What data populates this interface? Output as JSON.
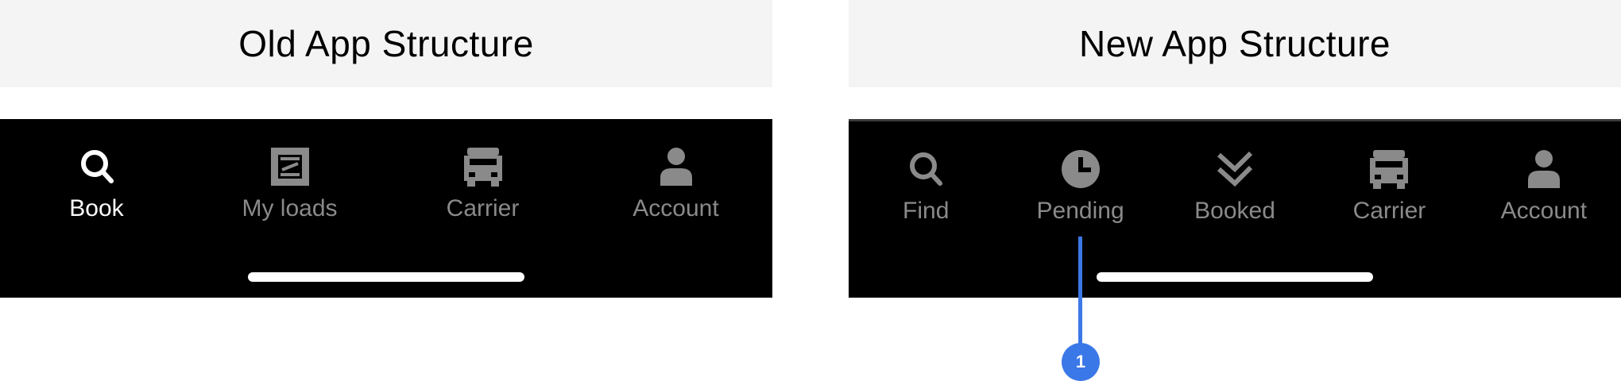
{
  "old_panel": {
    "title": "Old App Structure",
    "tabs": [
      {
        "label": "Book",
        "icon": "search-icon",
        "active": true
      },
      {
        "label": "My loads",
        "icon": "loads-icon",
        "active": false
      },
      {
        "label": "Carrier",
        "icon": "truck-icon",
        "active": false
      },
      {
        "label": "Account",
        "icon": "person-icon",
        "active": false
      }
    ]
  },
  "new_panel": {
    "title": "New App Structure",
    "tabs": [
      {
        "label": "Find",
        "icon": "search-icon",
        "active": false
      },
      {
        "label": "Pending",
        "icon": "clock-icon",
        "active": false
      },
      {
        "label": "Booked",
        "icon": "double-check-icon",
        "active": false
      },
      {
        "label": "Carrier",
        "icon": "truck-icon",
        "active": false
      },
      {
        "label": "Account",
        "icon": "person-icon",
        "active": false
      }
    ]
  },
  "callout": {
    "number": "1",
    "target": "Pending"
  },
  "colors": {
    "title_band": "#f4f4f4",
    "tabbar": "#000000",
    "active": "#ffffff",
    "inactive": "#8a8a8a",
    "callout": "#3b78e7"
  }
}
